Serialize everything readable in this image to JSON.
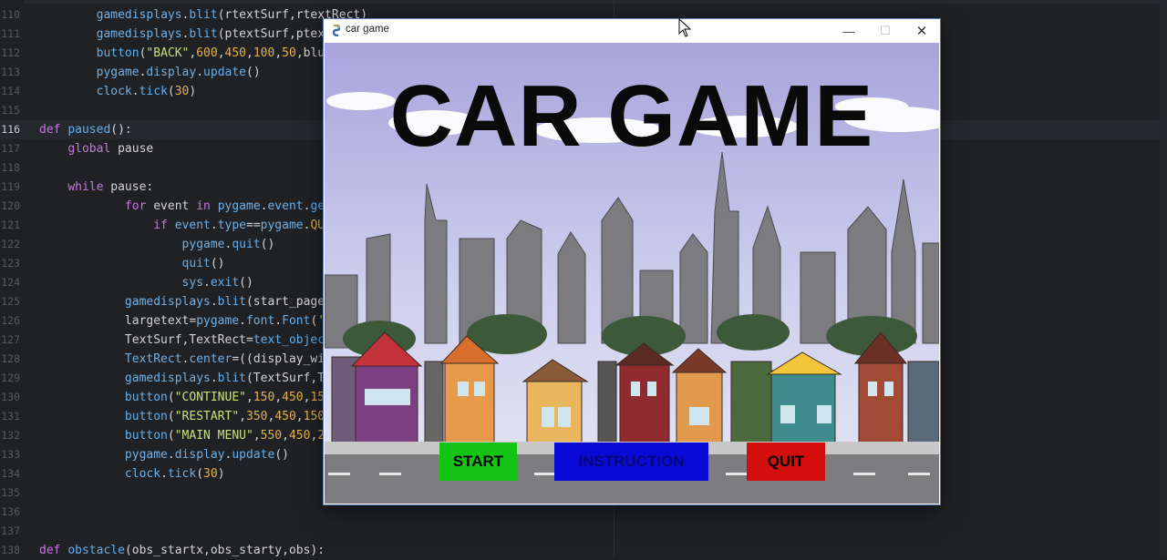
{
  "editor": {
    "lines": [
      {
        "no": "110",
        "html": "        <span class='b'>gamedisplays</span>.<span class='f'>blit</span>(rtextSurf,rtextRect)"
      },
      {
        "no": "111",
        "html": "        <span class='b'>gamedisplays</span>.<span class='f'>blit</span>(ptextSurf,ptex"
      },
      {
        "no": "112",
        "html": "        <span class='f'>button</span>(<span class='s'>\"BACK\"</span>,<span class='n'>600</span>,<span class='n'>450</span>,<span class='n'>100</span>,<span class='n'>50</span>,blu"
      },
      {
        "no": "113",
        "html": "        <span class='b'>pygame</span>.<span class='b'>display</span>.<span class='f'>update</span>()"
      },
      {
        "no": "114",
        "html": "        <span class='b'>clock</span>.<span class='f'>tick</span>(<span class='n'>30</span>)"
      },
      {
        "no": "115",
        "html": ""
      },
      {
        "no": "116",
        "html": "<span class='k'>def</span> <span class='f'>paused</span>():",
        "current": true
      },
      {
        "no": "117",
        "html": "    <span class='k'>global</span> pause"
      },
      {
        "no": "118",
        "html": ""
      },
      {
        "no": "119",
        "html": "    <span class='k'>while</span> pause:"
      },
      {
        "no": "120",
        "html": "            <span class='k'>for</span> event <span class='k'>in</span> <span class='b'>pygame</span>.<span class='b'>event</span>.<span class='f'>ge</span>"
      },
      {
        "no": "121",
        "html": "                <span class='k'>if</span> <span class='b'>event</span>.<span class='b'>type</span>==<span class='b'>pygame</span>.<span class='n'>QU</span>"
      },
      {
        "no": "122",
        "html": "                    <span class='b'>pygame</span>.<span class='f'>quit</span>()"
      },
      {
        "no": "123",
        "html": "                    <span class='f'>quit</span>()"
      },
      {
        "no": "124",
        "html": "                    <span class='b'>sys</span>.<span class='f'>exit</span>()"
      },
      {
        "no": "125",
        "html": "            <span class='b'>gamedisplays</span>.<span class='f'>blit</span>(start_page"
      },
      {
        "no": "126",
        "html": "            largetext=<span class='b'>pygame</span>.<span class='b'>font</span>.<span class='f'>Font</span>(<span class='s'>'</span>"
      },
      {
        "no": "127",
        "html": "            TextSurf,TextRect=<span class='f'>text_objec</span>"
      },
      {
        "no": "128",
        "html": "            <span class='b'>TextRect</span>.<span class='b'>center</span>=((display_wi"
      },
      {
        "no": "129",
        "html": "            <span class='b'>gamedisplays</span>.<span class='f'>blit</span>(TextSurf,T"
      },
      {
        "no": "130",
        "html": "            <span class='f'>button</span>(<span class='s'>\"CONTINUE\"</span>,<span class='n'>150</span>,<span class='n'>450</span>,<span class='n'>15</span>"
      },
      {
        "no": "131",
        "html": "            <span class='f'>button</span>(<span class='s'>\"RESTART\"</span>,<span class='n'>350</span>,<span class='n'>450</span>,<span class='n'>150</span>"
      },
      {
        "no": "132",
        "html": "            <span class='f'>button</span>(<span class='s'>\"MAIN MENU\"</span>,<span class='n'>550</span>,<span class='n'>450</span>,<span class='n'>2</span>"
      },
      {
        "no": "133",
        "html": "            <span class='b'>pygame</span>.<span class='b'>display</span>.<span class='f'>update</span>()"
      },
      {
        "no": "134",
        "html": "            <span class='b'>clock</span>.<span class='f'>tick</span>(<span class='n'>30</span>)"
      },
      {
        "no": "135",
        "html": ""
      },
      {
        "no": "136",
        "html": ""
      },
      {
        "no": "137",
        "html": ""
      },
      {
        "no": "138",
        "html": "<span class='k'>def</span> <span class='f'>obstacle</span>(obs_startx,obs_starty,obs):"
      }
    ]
  },
  "window": {
    "title": "car game",
    "minimize_glyph": "—",
    "maximize_glyph": "☐",
    "close_glyph": "✕",
    "icon": "pygame-snake-icon"
  },
  "game": {
    "title": "CAR GAME",
    "buttons": {
      "start": "START",
      "instruction": "INSTRUCTION",
      "quit": "QUIT"
    },
    "colors": {
      "start": "#14c414",
      "instruction": "#0a0ad6",
      "quit": "#d40d0d"
    }
  }
}
